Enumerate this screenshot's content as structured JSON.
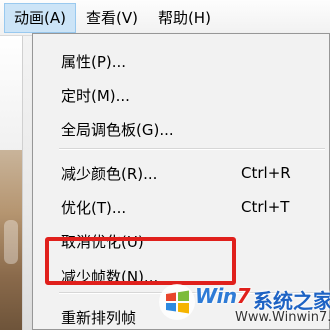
{
  "menubar": {
    "items": [
      {
        "label": "动画(A)",
        "active": true
      },
      {
        "label": "查看(V)"
      },
      {
        "label": "帮助(H)"
      }
    ]
  },
  "dropdown": {
    "items": [
      {
        "label": "属性(P)...",
        "shortcut": ""
      },
      {
        "label": "定时(M)...",
        "shortcut": ""
      },
      {
        "label": "全局调色板(G)...",
        "shortcut": ""
      },
      {
        "label": "减少颜色(R)...",
        "shortcut": "Ctrl+R"
      },
      {
        "label": "优化(T)...",
        "shortcut": "Ctrl+T"
      },
      {
        "label": "取消优化(U)",
        "shortcut": ""
      },
      {
        "label": "减少帧数(N)...",
        "shortcut": "",
        "highlighted": true
      },
      {
        "label": "重新排列帧",
        "shortcut": ""
      }
    ]
  },
  "watermark": {
    "brand_prefix": "Win",
    "brand_seven": "7",
    "site_name": "系统之家",
    "url": "Www.Winwin7.com"
  },
  "colors": {
    "highlight": "#e0201c",
    "menubar_active": "#cce4f7",
    "brand_blue": "#2e7bd6"
  }
}
